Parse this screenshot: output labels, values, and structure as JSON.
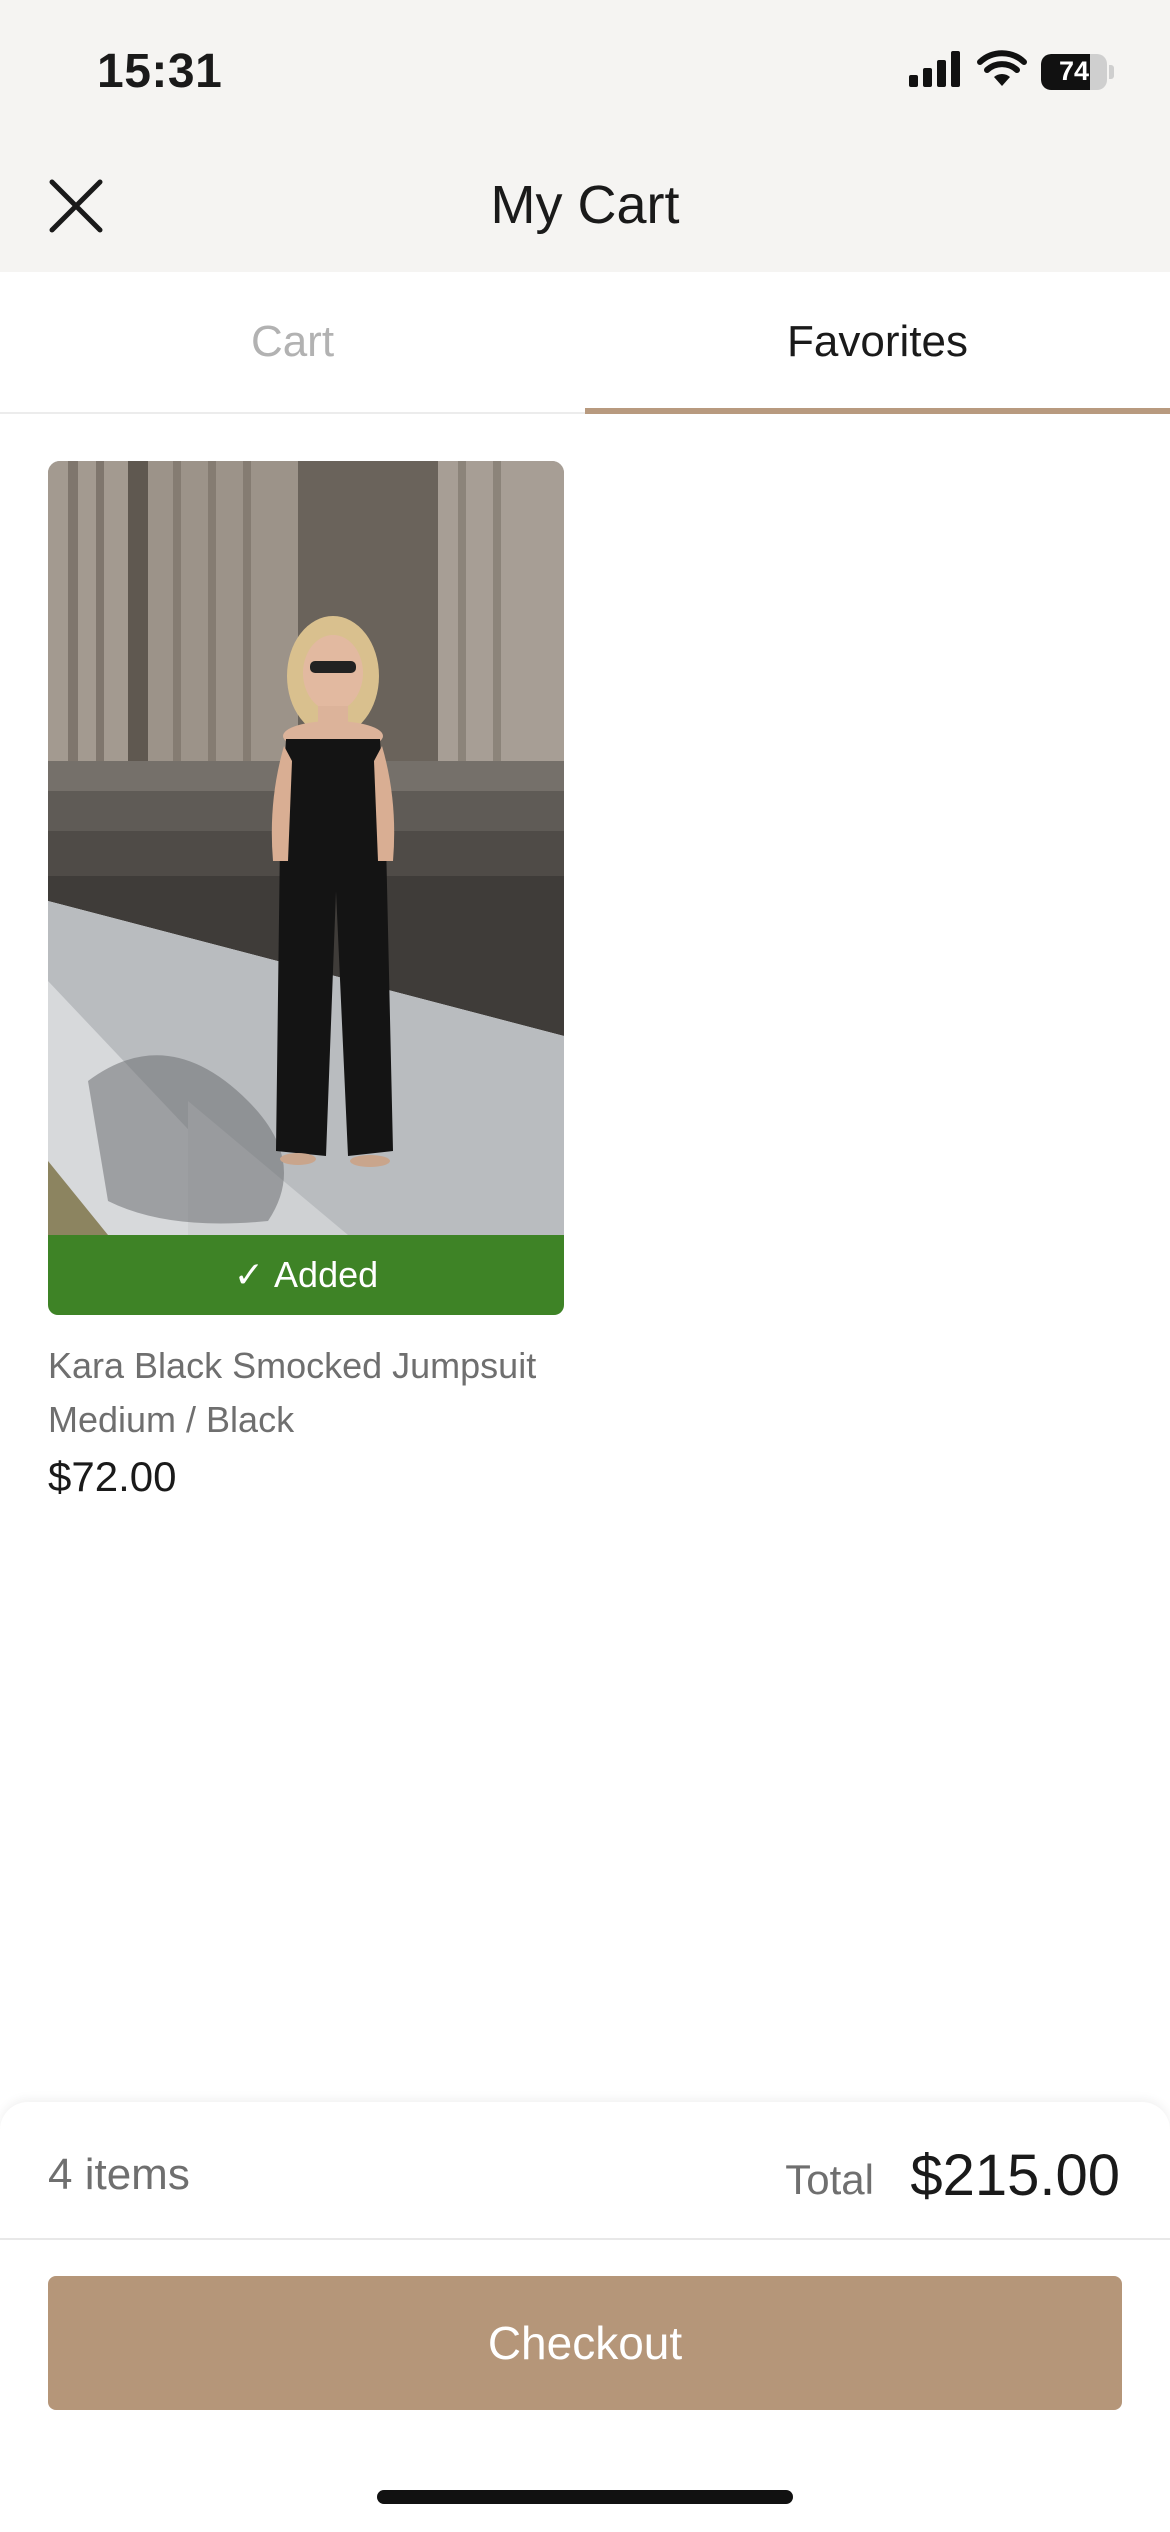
{
  "status_bar": {
    "time": "15:31",
    "battery_percent": "74",
    "battery_level": 0.74
  },
  "header": {
    "title": "My Cart",
    "close_icon": "close-icon"
  },
  "tabs": [
    {
      "label": "Cart",
      "active": false
    },
    {
      "label": "Favorites",
      "active": true
    }
  ],
  "favorites": [
    {
      "status_label": "Added",
      "status_icon": "checkmark-icon",
      "name": "Kara Black Smocked Jumpsuit",
      "variant": "Medium / Black",
      "price": "$72.00"
    }
  ],
  "summary": {
    "items_count": "4 items",
    "total_label": "Total",
    "total_value": "$215.00"
  },
  "checkout_label": "Checkout",
  "colors": {
    "accent": "#b59679",
    "tab_underline": "#b89a7f",
    "added_green": "#3e8326",
    "header_bg": "#f5f4f2"
  }
}
